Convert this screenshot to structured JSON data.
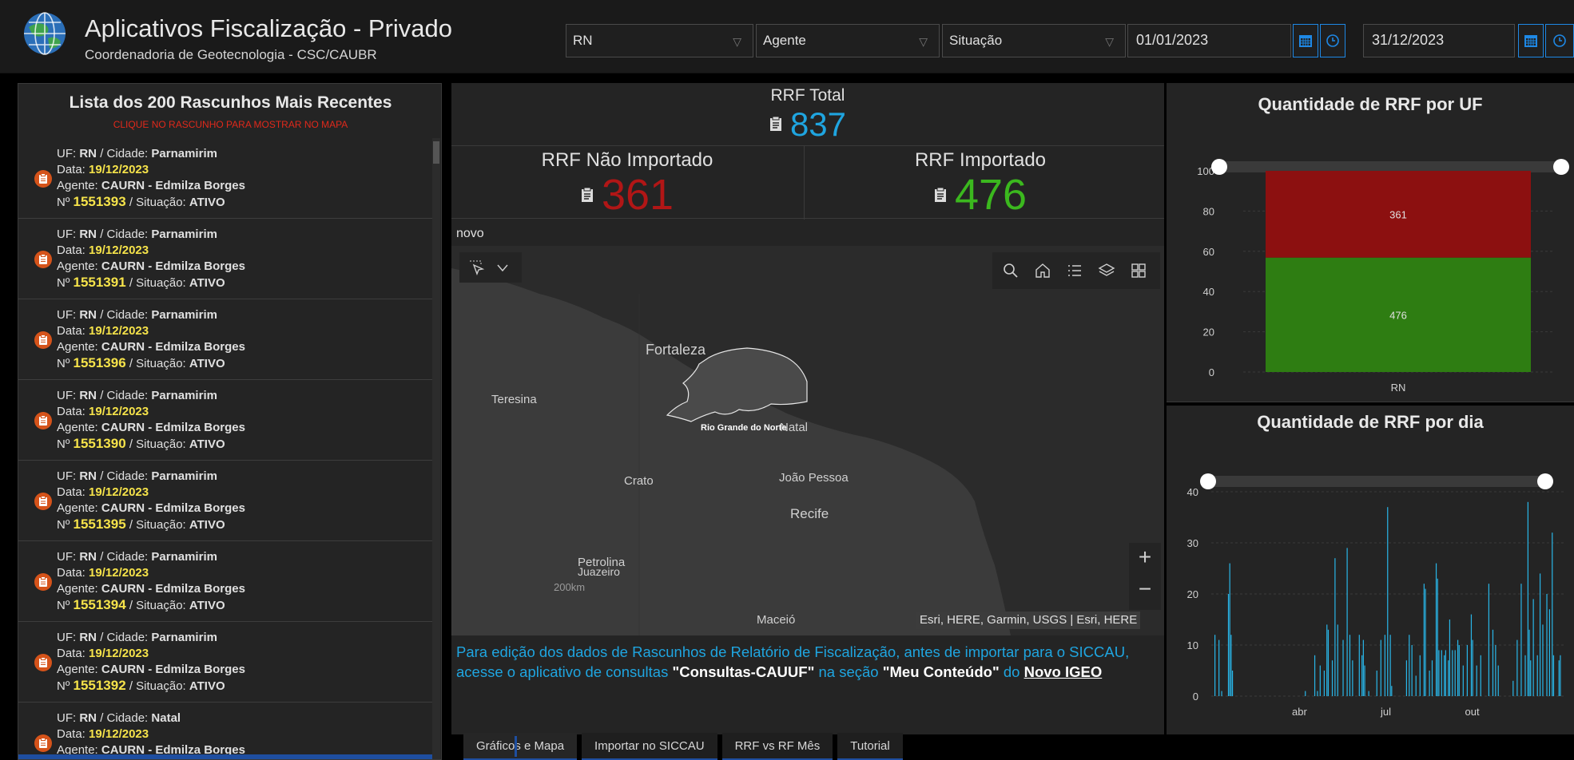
{
  "header": {
    "title": "Aplicativos Fiscalização - Privado",
    "subtitle": "Coordenadoria de Geotecnologia - CSC/CAUBR",
    "filters": {
      "uf": "RN",
      "agente": "Agente",
      "situacao": "Situação",
      "date_start": "01/01/2023",
      "date_end": "31/12/2023"
    }
  },
  "list": {
    "title": "Lista dos 200 Rascunhos Mais Recentes",
    "hint": "CLIQUE NO RASCUNHO PARA MOSTRAR NO MAPA",
    "labels": {
      "uf": "UF:",
      "cidade": "/ Cidade:",
      "data": "Data:",
      "agente": "Agente:",
      "numero": "Nº",
      "situacao": "/ Situação:"
    },
    "items": [
      {
        "uf": "RN",
        "cidade": "Parnamirim",
        "data": "19/12/2023",
        "agente": "CAURN - Edmilza Borges",
        "numero": "1551393",
        "situacao": "ATIVO"
      },
      {
        "uf": "RN",
        "cidade": "Parnamirim",
        "data": "19/12/2023",
        "agente": "CAURN - Edmilza Borges",
        "numero": "1551391",
        "situacao": "ATIVO"
      },
      {
        "uf": "RN",
        "cidade": "Parnamirim",
        "data": "19/12/2023",
        "agente": "CAURN - Edmilza Borges",
        "numero": "1551396",
        "situacao": "ATIVO"
      },
      {
        "uf": "RN",
        "cidade": "Parnamirim",
        "data": "19/12/2023",
        "agente": "CAURN - Edmilza Borges",
        "numero": "1551390",
        "situacao": "ATIVO"
      },
      {
        "uf": "RN",
        "cidade": "Parnamirim",
        "data": "19/12/2023",
        "agente": "CAURN - Edmilza Borges",
        "numero": "1551395",
        "situacao": "ATIVO"
      },
      {
        "uf": "RN",
        "cidade": "Parnamirim",
        "data": "19/12/2023",
        "agente": "CAURN - Edmilza Borges",
        "numero": "1551394",
        "situacao": "ATIVO"
      },
      {
        "uf": "RN",
        "cidade": "Parnamirim",
        "data": "19/12/2023",
        "agente": "CAURN - Edmilza Borges",
        "numero": "1551392",
        "situacao": "ATIVO"
      },
      {
        "uf": "RN",
        "cidade": "Natal",
        "data": "19/12/2023",
        "agente": "CAURN - Edmilza Borges",
        "numero": "",
        "situacao": ""
      }
    ]
  },
  "kpi": {
    "total_label": "RRF Total",
    "total_value": "837",
    "nao_importado_label": "RRF Não Importado",
    "nao_importado_value": "361",
    "importado_label": "RRF Importado",
    "importado_value": "476"
  },
  "map": {
    "tag": "novo",
    "attribution": "Esri, HERE, Garmin, USGS | Esri, HERE",
    "scale": "200km",
    "labels": {
      "fortaleza": "Fortaleza",
      "teresina": "Teresina",
      "rn": "Rio Grande do Norte",
      "natal": "Natal",
      "crato": "Crato",
      "joao_pessoa": "João Pessoa",
      "recife": "Recife",
      "petrolina": "Petrolina",
      "juazeiro": "Juazeiro",
      "maceio": "Maceió"
    },
    "zoom_in": "+",
    "zoom_out": "−"
  },
  "info": {
    "text1": "Para edição dos dados de Rascunhos de Relatório de Fiscalização, antes de importar para o SICCAU, acesse o aplicativo de consultas ",
    "link1": "\"Consultas-CAUUF\"",
    "text2": " na seção ",
    "link2": "\"Meu Conteúdo\"",
    "text3": " do ",
    "link3": "Novo IGEO"
  },
  "tabs": [
    {
      "label": "Gráficos e Mapa"
    },
    {
      "label": "Importar no SICCAU"
    },
    {
      "label": "RRF vs RF Mês"
    },
    {
      "label": "Tutorial"
    }
  ],
  "chart_data": [
    {
      "type": "bar",
      "title": "Quantidade de RRF por UF",
      "categories": [
        "RN"
      ],
      "series": [
        {
          "values": [
            476
          ],
          "color": "#2e7d12"
        },
        {
          "values": [
            361
          ],
          "color": "#8c1010"
        }
      ],
      "stacked": true,
      "normalized_percent": true,
      "ylim": [
        0,
        100
      ],
      "yticks": [
        0,
        20,
        40,
        60,
        80,
        100
      ]
    },
    {
      "type": "bar",
      "title": "Quantidade de RRF por dia",
      "xticks": [
        "abr",
        "jul",
        "out"
      ],
      "ylim": [
        0,
        40
      ],
      "yticks": [
        0,
        10,
        20,
        30,
        40
      ],
      "color": "#29b6e8",
      "values": [
        12,
        0,
        0,
        11,
        0,
        1,
        0,
        0,
        0,
        0,
        20,
        26,
        12,
        5,
        0,
        0,
        0,
        0,
        0,
        0,
        0,
        0,
        0,
        0,
        0,
        0,
        0,
        0,
        0,
        0,
        0,
        0,
        0,
        0,
        0,
        0,
        0,
        0,
        0,
        0,
        0,
        0,
        0,
        0,
        0,
        0,
        0,
        0,
        0,
        0,
        0,
        0,
        0,
        0,
        0,
        0,
        0,
        0,
        0,
        0,
        0,
        0,
        0,
        0,
        0,
        0,
        0,
        1,
        0,
        0,
        0,
        0,
        0,
        0,
        8,
        0,
        1,
        0,
        6,
        0,
        0,
        5,
        0,
        14,
        13,
        0,
        0,
        7,
        0,
        27,
        0,
        14,
        0,
        0,
        0,
        11,
        0,
        0,
        29,
        0,
        12,
        0,
        7,
        0,
        0,
        0,
        0,
        12,
        0,
        8,
        11,
        6,
        0,
        0,
        1,
        0,
        0,
        0,
        0,
        0,
        5,
        0,
        0,
        11,
        0,
        0,
        12,
        0,
        37,
        0,
        12,
        2,
        0,
        0,
        0,
        0,
        0,
        0,
        0,
        0,
        0,
        0,
        7,
        0,
        12,
        0,
        10,
        0,
        0,
        4,
        0,
        0,
        8,
        0,
        0,
        22,
        21,
        0,
        0,
        5,
        0,
        7,
        0,
        0,
        26,
        23,
        9,
        0,
        9,
        0,
        8,
        9,
        0,
        7,
        15,
        0,
        9,
        0,
        9,
        0,
        11,
        10,
        0,
        0,
        6,
        0,
        0,
        10,
        0,
        0,
        16,
        11,
        0,
        0,
        6,
        0,
        0,
        8,
        0,
        0,
        0,
        0,
        0,
        22,
        0,
        0,
        13,
        0,
        10,
        0,
        6,
        0,
        0,
        0,
        0,
        0,
        0,
        0,
        0,
        0,
        0,
        3,
        0,
        0,
        11,
        0,
        0,
        22,
        0,
        0,
        8,
        0,
        38,
        13,
        7,
        0,
        19,
        0,
        0,
        8,
        0,
        24,
        0,
        14,
        0,
        0,
        20,
        0,
        17,
        0,
        32,
        8,
        0,
        0,
        0,
        7,
        8
      ]
    }
  ]
}
